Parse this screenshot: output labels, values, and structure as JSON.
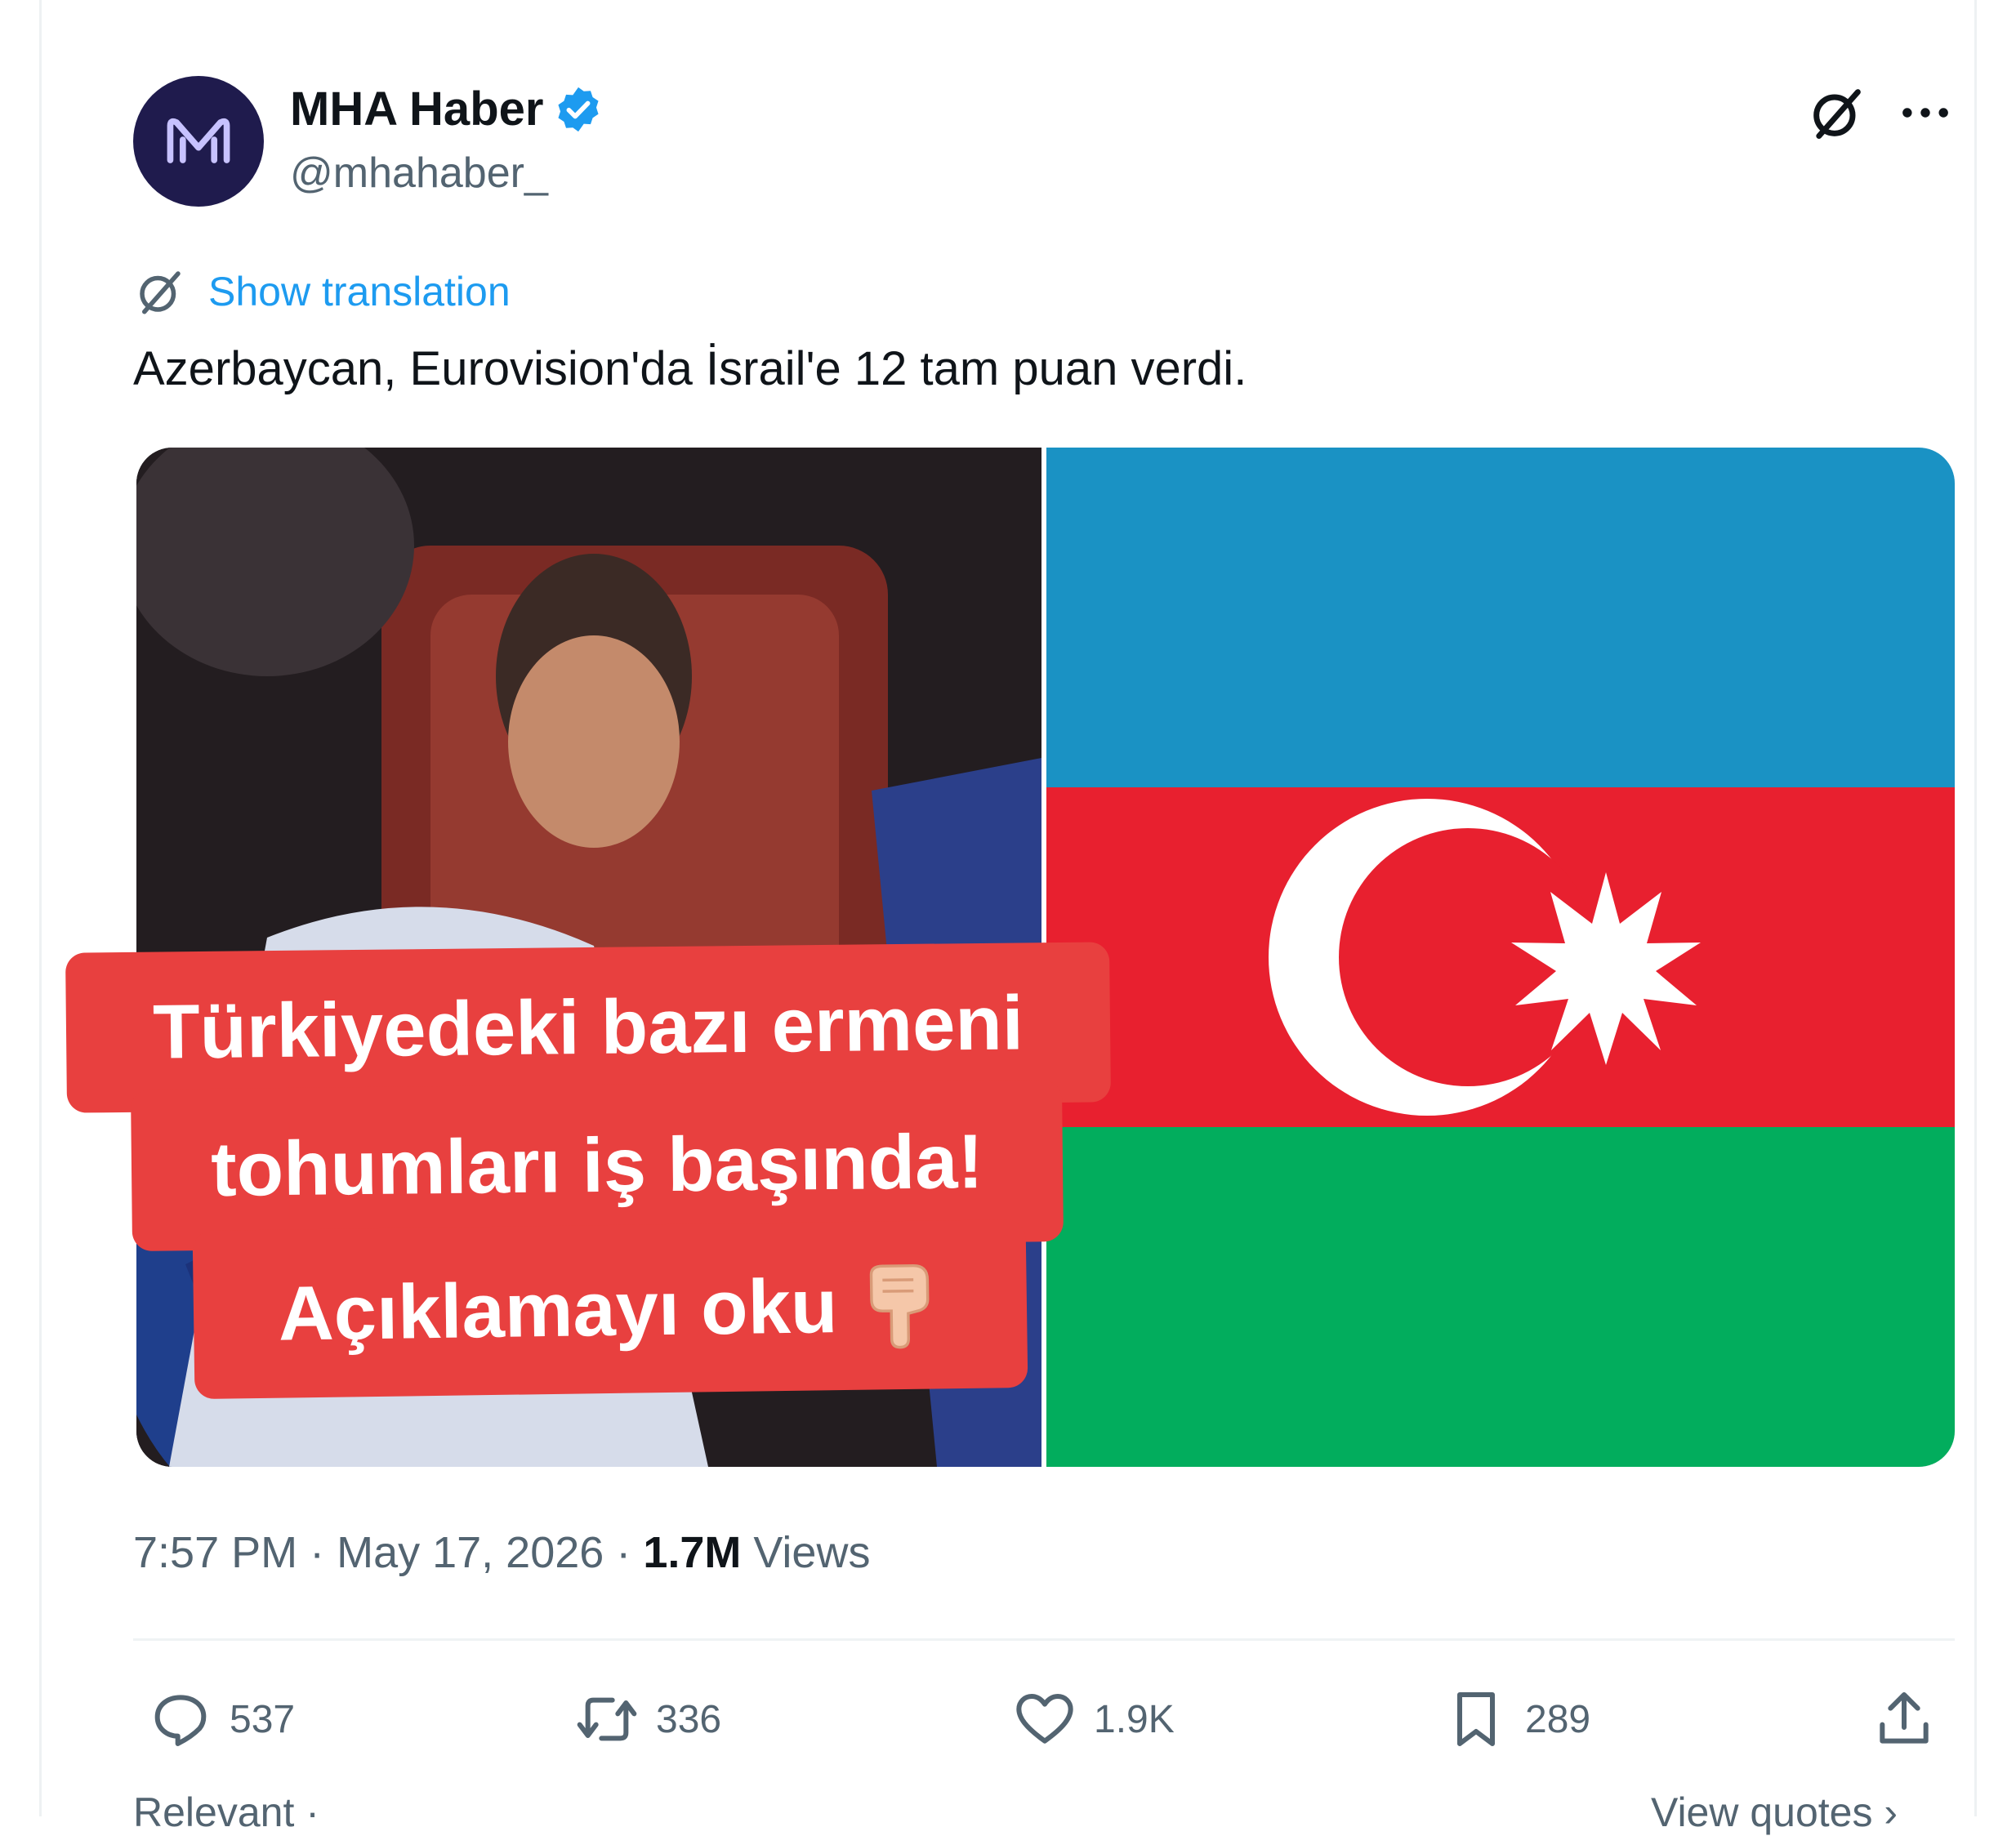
{
  "post": {
    "author": {
      "display_name": "MHA Haber",
      "handle": "@mhahaber_",
      "avatar_icon": "mha-logo",
      "verified": true,
      "verified_color": "#1d9bf0"
    },
    "header_actions": [
      "grok-icon",
      "more-icon"
    ],
    "show_translation": "Show translation",
    "text": "Azerbaycan, Eurovision'da İsrail'e 12 tam puan verdi.",
    "media": {
      "left": "photo of performer wrapped in Israeli flag blowing a kiss",
      "right": "flag of Azerbaijan",
      "flag_colors": [
        "#1a92c4",
        "#e8202f",
        "#02ad5d"
      ]
    },
    "overlay_caption": {
      "line1": "Türkiyedeki bazı ermeni",
      "line2": "tohumları iş başında!",
      "line3": "Açıklamayı oku",
      "background": "#e8403f"
    },
    "timestamp": "7:57 PM · May 17, 2026 ·",
    "views_count": "1.7M",
    "views_label": "Views",
    "stats": {
      "replies": "537",
      "reposts": "336",
      "likes": "1.9K",
      "bookmarks": "289"
    },
    "footer": {
      "left": "Relevant ·",
      "right": "View quotes ›"
    }
  }
}
